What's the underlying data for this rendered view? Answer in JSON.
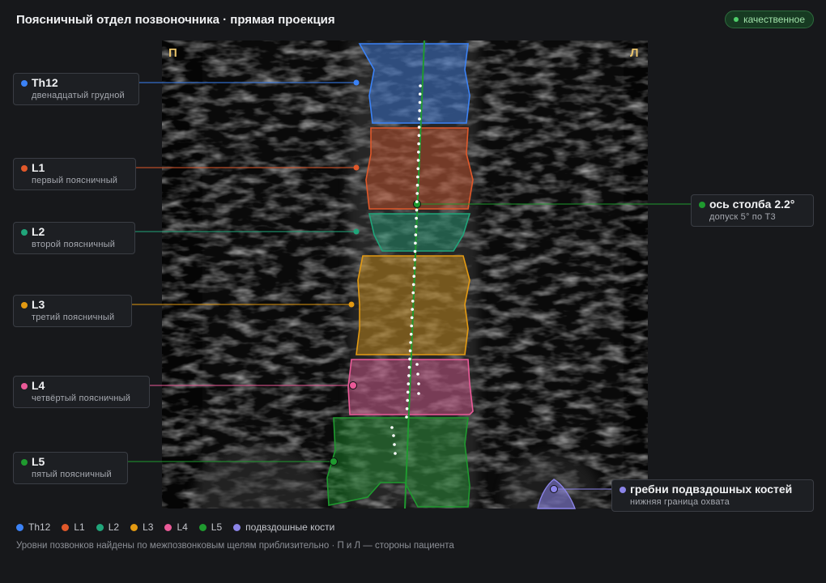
{
  "header": {
    "title": "Поясничный отдел позвоночника · прямая проекция"
  },
  "badge": {
    "label": "качественное",
    "color": "#4fcf6a"
  },
  "scan": {
    "left_marker": "П",
    "right_marker": "Л"
  },
  "vertebrae": [
    {
      "id": "th12",
      "title": "Th12",
      "subtitle": "двенадцатый грудной",
      "color": "#3b82f6"
    },
    {
      "id": "l1",
      "title": "L1",
      "subtitle": "первый поясничный",
      "color": "#e0582a"
    },
    {
      "id": "l2",
      "title": "L2",
      "subtitle": "второй поясничный",
      "color": "#20a57a"
    },
    {
      "id": "l3",
      "title": "L3",
      "subtitle": "третий поясничный",
      "color": "#e39a12"
    },
    {
      "id": "l4",
      "title": "L4",
      "subtitle": "четвёртый поясничный",
      "color": "#ea5a98"
    },
    {
      "id": "l5",
      "title": "L5",
      "subtitle": "пятый поясничный",
      "color": "#1f9a2f"
    }
  ],
  "axis": {
    "title": "ось столба 2.2°",
    "subtitle": "допуск 5° по Т3",
    "color": "#1f9a2f"
  },
  "iliac": {
    "title": "гребни подвздошных костей",
    "subtitle": "нижняя граница охвата",
    "color": "#8b84e8"
  },
  "legend": [
    {
      "label": "Th12",
      "color": "#3b82f6"
    },
    {
      "label": "L1",
      "color": "#e0582a"
    },
    {
      "label": "L2",
      "color": "#20a57a"
    },
    {
      "label": "L3",
      "color": "#e39a12"
    },
    {
      "label": "L4",
      "color": "#ea5a98"
    },
    {
      "label": "L5",
      "color": "#1f9a2f"
    },
    {
      "label": "подвздошные кости",
      "color": "#8b84e8"
    }
  ],
  "footnote": "Уровни позвонков найдены по межпозвонковым щелям приблизительно · П и Л — стороны пациента"
}
